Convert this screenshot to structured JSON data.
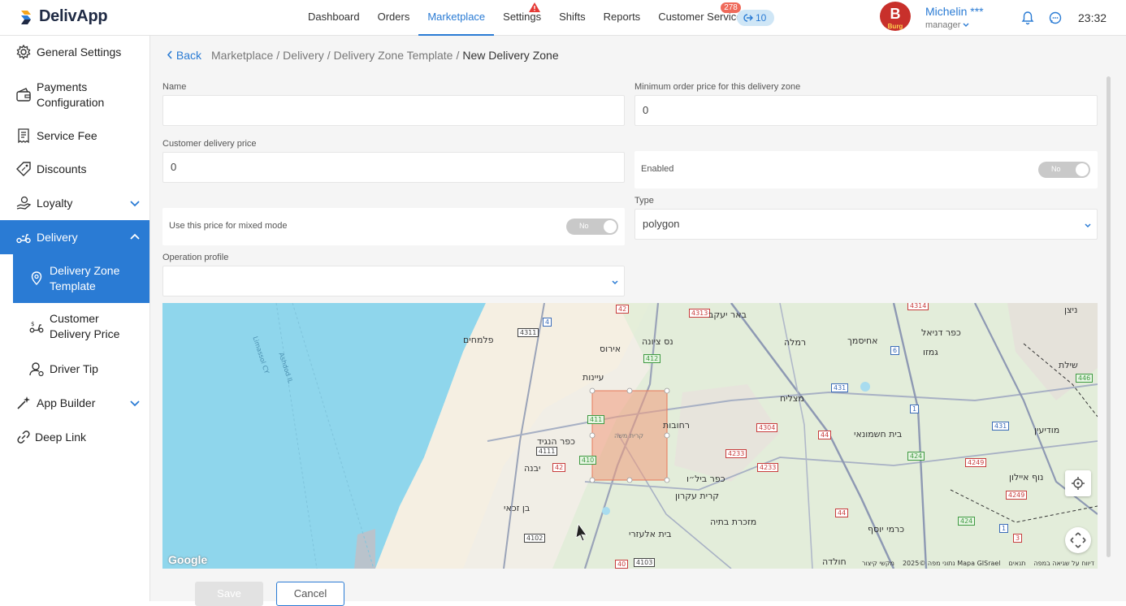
{
  "app": {
    "name": "DelivApp"
  },
  "nav": {
    "items": [
      "Dashboard",
      "Orders",
      "Marketplace",
      "Settings",
      "Shifts",
      "Reports",
      "Customer Service"
    ],
    "active": "Marketplace",
    "customer_service_badge": "278",
    "customer_service_pill": "10"
  },
  "user": {
    "name": "Michelin ***",
    "role": "manager",
    "avatar_letter": "B",
    "avatar_brand": "Burg"
  },
  "clock": "23:32",
  "sidebar": {
    "items": [
      {
        "label": "General Settings",
        "icon": "gear-icon"
      },
      {
        "label": "Payments Configuration",
        "icon": "wallet-icon"
      },
      {
        "label": "Service Fee",
        "icon": "receipt-icon"
      },
      {
        "label": "Discounts",
        "icon": "tag-icon"
      },
      {
        "label": "Loyalty",
        "icon": "hand-coin-icon"
      },
      {
        "label": "Delivery",
        "icon": "scooter-icon"
      },
      {
        "label": "Delivery Zone Template",
        "icon": "map-pin-icon"
      },
      {
        "label": "Customer Delivery Price",
        "icon": "scooter-price-icon"
      },
      {
        "label": "Driver Tip",
        "icon": "driver-icon"
      },
      {
        "label": "App Builder",
        "icon": "app-builder-icon"
      },
      {
        "label": "Deep Link",
        "icon": "link-icon"
      }
    ]
  },
  "breadcrumb": {
    "back": "Back",
    "path": [
      "Marketplace",
      "Delivery",
      "Delivery Zone Template"
    ],
    "separator": "/",
    "current": "New Delivery Zone"
  },
  "form": {
    "name_label": "Name",
    "name_value": "",
    "min_order_label": "Minimum order price for this delivery zone",
    "min_order_value": "0",
    "customer_price_label": "Customer delivery price",
    "customer_price_value": "0",
    "enabled_label": "Enabled",
    "enabled_toggle": "No",
    "mixed_mode_label": "Use this price for mixed mode",
    "mixed_mode_toggle": "No",
    "type_label": "Type",
    "type_value": "polygon",
    "operation_profile_label": "Operation profile",
    "operation_profile_value": ""
  },
  "map": {
    "places": [
      "פלמחים",
      "נס ציונה",
      "באר יעקב",
      "אירוס",
      "עיינות",
      "רחובות",
      "כפר הנגיד",
      "יבנה",
      "כפר ביל״ו",
      "קרית עקרון",
      "בן זכאי",
      "בית אלעזרי",
      "מזכרת בתיה",
      "בית חשמונאי",
      "מצליח",
      "כפר דניאל",
      "אחיסמך",
      "גמזו",
      "ניצן",
      "שילת",
      "מודיעין",
      "נוף איילון",
      "כרמי יוסף",
      "חולדה",
      "רמלה",
      "קרית משה"
    ],
    "road_numbers": [
      "42",
      "4313",
      "4314",
      "4",
      "4311",
      "412",
      "411",
      "410",
      "4111",
      "42",
      "4304",
      "44",
      "4233",
      "4233",
      "431",
      "1",
      "6",
      "446",
      "431",
      "424",
      "4249",
      "4249",
      "424",
      "3",
      "1",
      "40",
      "4103",
      "4102",
      "44"
    ],
    "sea_labels": [
      "Limassol CY",
      "Ashdod IL"
    ],
    "footer": [
      "דיווח על שגיאה במפה",
      "תנאים",
      "נתוני מפה ©2025 Mapa GISrael",
      "מקשי קיצור"
    ],
    "attribution": "Google"
  },
  "actions": {
    "save": "Save",
    "cancel": "Cancel"
  }
}
